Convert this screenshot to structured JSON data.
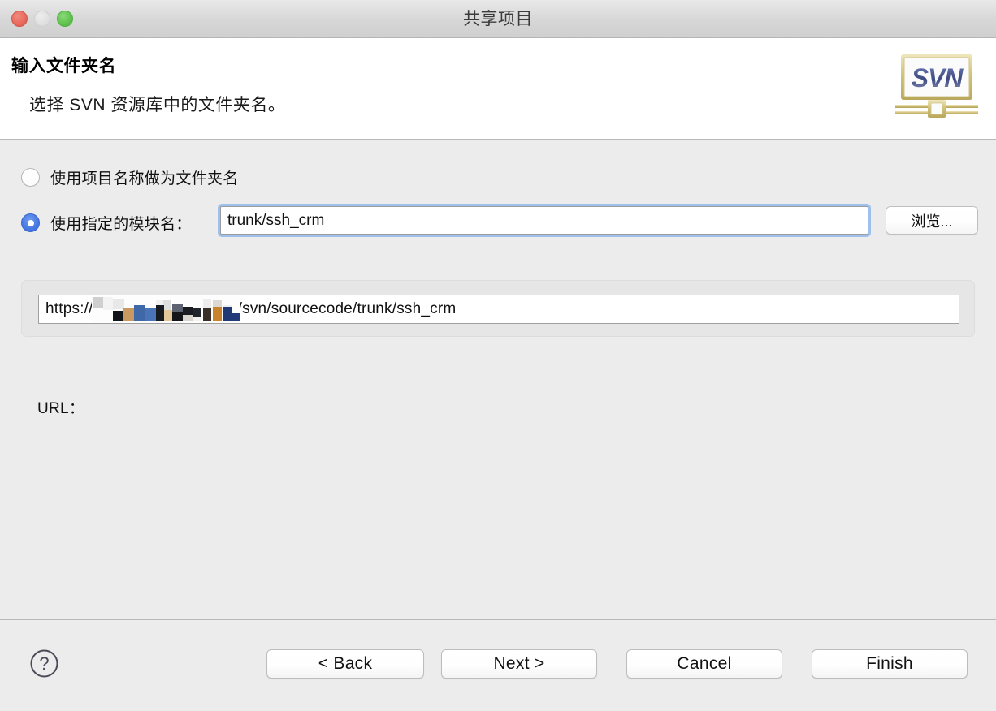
{
  "window": {
    "title": "共享项目",
    "controls": {
      "close": "close-button",
      "minimize": "minimize-button",
      "maximize": "maximize-button"
    }
  },
  "header": {
    "title": "输入文件夹名",
    "description": "选择 SVN 资源库中的文件夹名。",
    "logo_text": "SVN"
  },
  "form": {
    "option_project_name": {
      "label": "使用项目名称做为文件夹名",
      "selected": false
    },
    "option_module_name": {
      "label": "使用指定的模块名：",
      "selected": true
    },
    "module_field": {
      "value": "trunk/ssh_crm",
      "placeholder": ""
    },
    "browse_label": "浏览...",
    "url_label": "URL：",
    "url": {
      "prefix": "https://",
      "redacted_host": "",
      "suffix": "/svn/sourcecode/trunk/ssh_crm",
      "full_display": "https://[redacted]/svn/sourcecode/trunk/ssh_crm"
    }
  },
  "footer": {
    "help_label": "?",
    "back_label": "< Back",
    "next_label": "Next >",
    "cancel_label": "Cancel",
    "finish_label": "Finish"
  },
  "colors": {
    "titlebar_bg": "#d8d8d8",
    "body_bg": "#ececec",
    "header_bg": "#ffffff",
    "accent_radio": "#4a7ae4",
    "focus_ring": "#9fc0ec",
    "close_light": "#e8695c",
    "minimize_light": "#e0e0e0",
    "maximize_light": "#5fc24e",
    "svn_logo_text": "#4c5a93",
    "svn_logo_frame": "#c8b96a"
  }
}
